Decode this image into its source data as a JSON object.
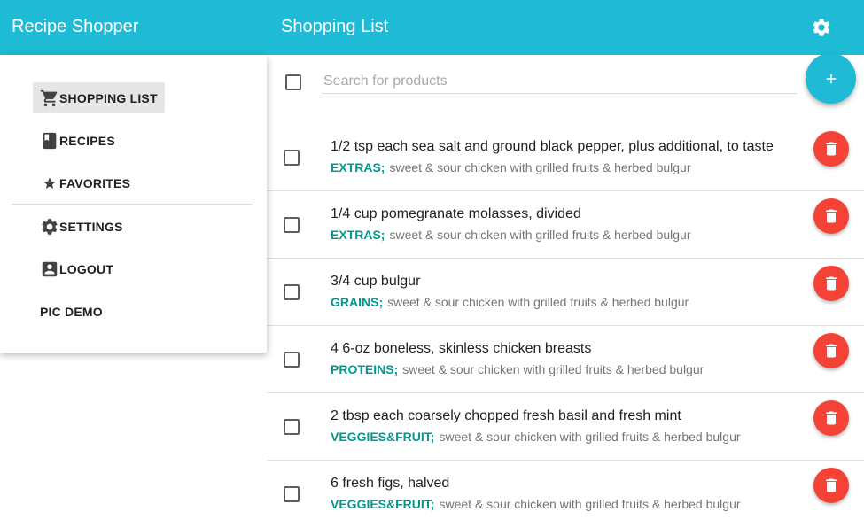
{
  "appbar": {
    "app_title": "Recipe Shopper",
    "page_title": "Shopping List",
    "settings_icon": "gear-icon",
    "background_color": "#1fbad6"
  },
  "sidebar": {
    "items": [
      {
        "label": "SHOPPING LIST",
        "icon": "cart-icon",
        "active": true
      },
      {
        "label": "RECIPES",
        "icon": "book-icon",
        "active": false
      },
      {
        "label": "FAVORITES",
        "icon": "star-icon",
        "active": false
      },
      {
        "label": "SETTINGS",
        "icon": "gear-icon",
        "active": false
      },
      {
        "label": "LOGOUT",
        "icon": "account-icon",
        "active": false
      },
      {
        "label": "PIC DEMO",
        "icon": "",
        "active": false
      }
    ]
  },
  "search": {
    "placeholder": "Search for products",
    "value": ""
  },
  "add_button": {
    "icon": "plus-icon",
    "color": "#1fbad6"
  },
  "colors": {
    "category": "#00998f",
    "delete": "#f44336"
  },
  "list": {
    "items": [
      {
        "name": "1/2 tsp each sea salt and ground black pepper, plus additional, to taste",
        "category": "EXTRAS;",
        "recipe": "sweet & sour chicken with grilled fruits & herbed bulgur",
        "checked": false
      },
      {
        "name": "1/4 cup pomegranate molasses, divided",
        "category": "EXTRAS;",
        "recipe": "sweet & sour chicken with grilled fruits & herbed bulgur",
        "checked": false
      },
      {
        "name": "3/4 cup bulgur",
        "category": "GRAINS;",
        "recipe": "sweet & sour chicken with grilled fruits & herbed bulgur",
        "checked": false
      },
      {
        "name": "4 6-oz boneless, skinless chicken breasts",
        "category": "PROTEINS;",
        "recipe": "sweet & sour chicken with grilled fruits & herbed bulgur",
        "checked": false
      },
      {
        "name": "2 tbsp each coarsely chopped fresh basil and fresh mint",
        "category": "VEGGIES&FRUIT;",
        "recipe": "sweet & sour chicken with grilled fruits & herbed bulgur",
        "checked": false
      },
      {
        "name": "6 fresh figs, halved",
        "category": "VEGGIES&FRUIT;",
        "recipe": "sweet & sour chicken with grilled fruits & herbed bulgur",
        "checked": false
      }
    ]
  }
}
